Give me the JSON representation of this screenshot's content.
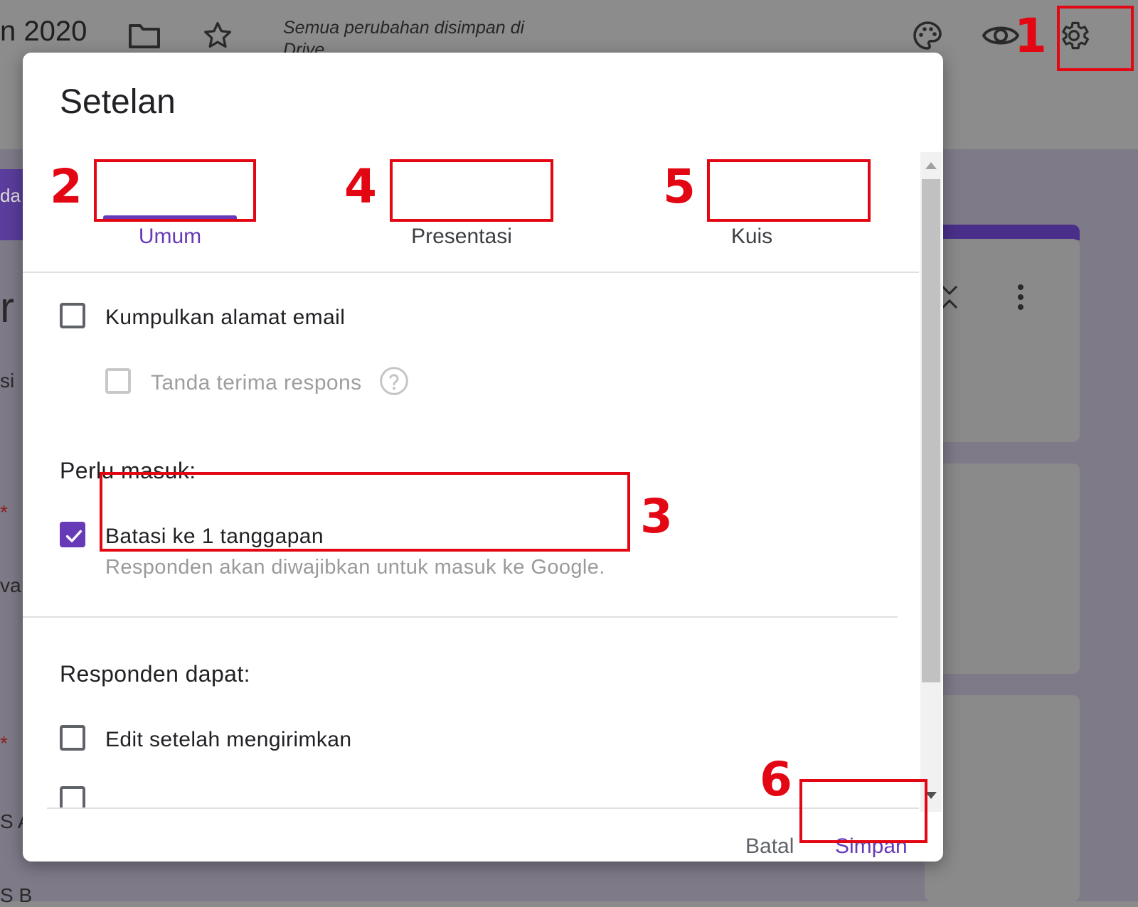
{
  "background": {
    "form_title": "n 2020",
    "save_status": "Semua perubahan disimpan di Drive",
    "tab_fragment": "da",
    "text_fragments": [
      "r",
      "si",
      "*",
      "va",
      "*",
      "S A",
      "S B"
    ]
  },
  "dialog": {
    "title": "Setelan",
    "tabs": [
      {
        "label": "Umum",
        "active": true
      },
      {
        "label": "Presentasi",
        "active": false
      },
      {
        "label": "Kuis",
        "active": false
      }
    ],
    "options": {
      "collect_email": {
        "label": "Kumpulkan alamat email",
        "checked": false
      },
      "response_receipt": {
        "label": "Tanda terima respons",
        "checked": false,
        "disabled": true
      },
      "require_signin_heading": "Perlu masuk:",
      "limit_one": {
        "label": "Batasi ke 1 tanggapan",
        "sublabel": "Responden akan diwajibkan untuk masuk ke Google.",
        "checked": true
      },
      "respondents_can_heading": "Responden dapat:",
      "edit_after_submit": {
        "label": "Edit setelah mengirimkan",
        "checked": false
      }
    },
    "buttons": {
      "cancel": "Batal",
      "save": "Simpan"
    }
  },
  "annotations": [
    "1",
    "2",
    "3",
    "4",
    "5",
    "6"
  ],
  "colors": {
    "accent": "#673ab7",
    "annotation": "#e30613"
  }
}
